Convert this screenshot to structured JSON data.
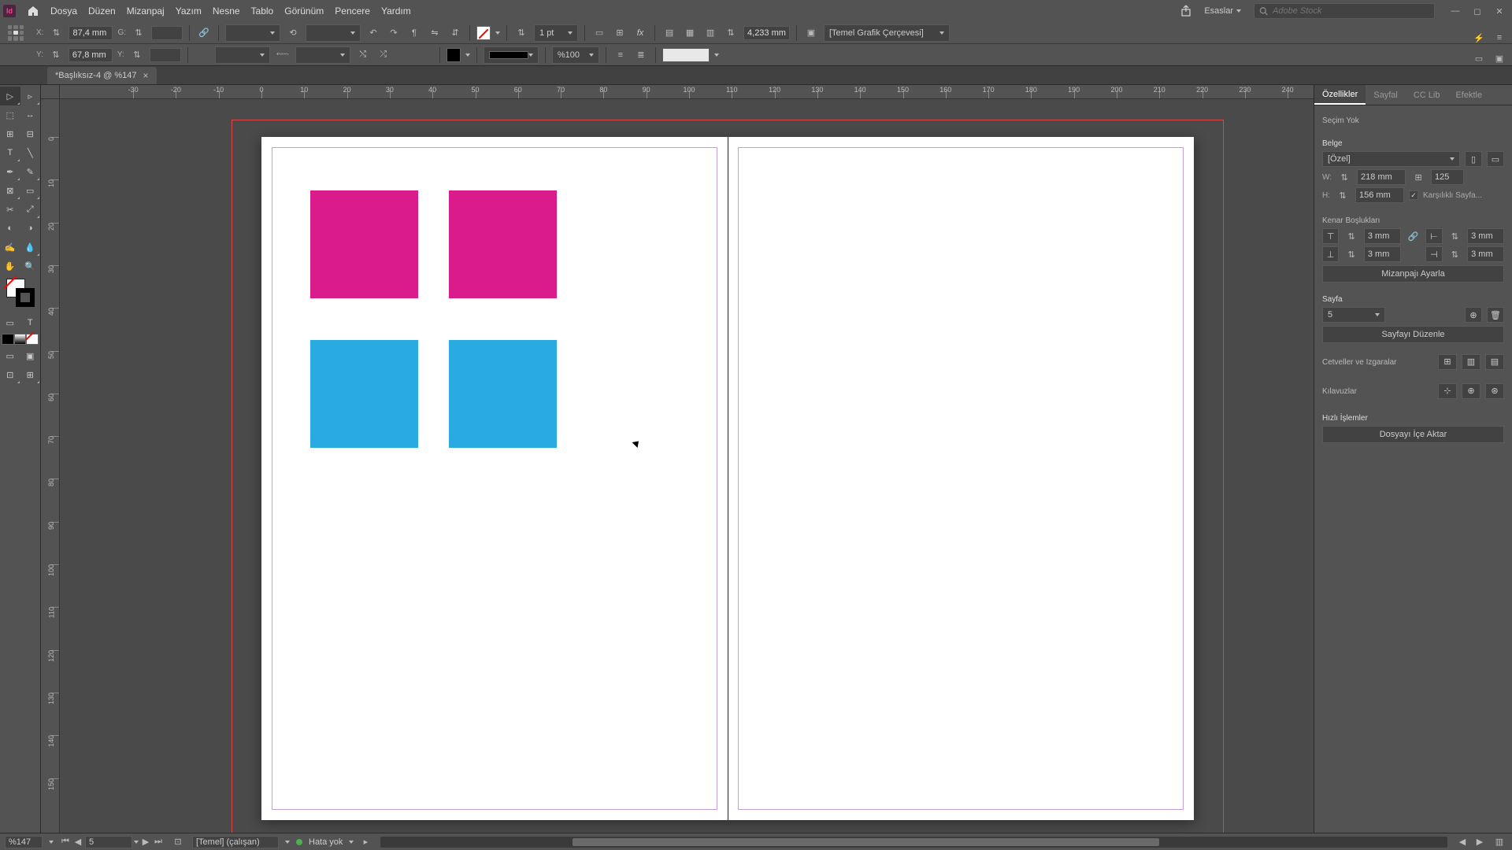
{
  "menu": {
    "file": "Dosya",
    "edit": "Düzen",
    "layout": "Mizanpaj",
    "type": "Yazım",
    "object": "Nesne",
    "table": "Tablo",
    "view": "Görünüm",
    "window": "Pencere",
    "help": "Yardım"
  },
  "workspace": "Esaslar",
  "search_placeholder": "Adobe Stock",
  "control": {
    "x": "87,4 mm",
    "y": "67,8 mm",
    "g": "",
    "stroke_weight": "1 pt",
    "corner": "4,233 mm",
    "zoom": "%100",
    "object_style": "[Temel Grafik Çerçevesi]",
    "opacity": ""
  },
  "doc_tab": "*Başlıksız-4 @ %147",
  "ruler_h": [
    -30,
    -20,
    -10,
    0,
    10,
    20,
    30,
    40,
    50,
    60,
    70,
    80,
    90,
    100,
    110,
    120,
    130,
    140,
    150,
    160,
    170,
    180,
    190,
    200,
    210,
    220,
    230,
    240
  ],
  "ruler_v": [
    0,
    10,
    20,
    30,
    40,
    50,
    60,
    70,
    80,
    90,
    100,
    110,
    120,
    130,
    140,
    150
  ],
  "panel": {
    "tabs": {
      "properties": "Özellikler",
      "pages": "Sayfal",
      "cclib": "CC Lib",
      "effects": "Efektle"
    },
    "no_selection": "Seçim Yok",
    "document": "Belge",
    "preset": "[Özel]",
    "w_label": "W:",
    "w": "218 mm",
    "h_label": "H:",
    "h": "156 mm",
    "pages": "125",
    "facing": "Karşılıklı Sayfa...",
    "margins_title": "Kenar Boşlukları",
    "m1": "3 mm",
    "m2": "3 mm",
    "m3": "3 mm",
    "m4": "3 mm",
    "adjust_layout": "Mizanpajı Ayarla",
    "page_title": "Sayfa",
    "page_num": "5",
    "edit_page": "Sayfayı Düzenle",
    "rulers_grids": "Cetveller ve Izgaralar",
    "guides": "Kılavuzlar",
    "quick": "Hızlı İşlemler",
    "place": "Dosyayı İçe Aktar"
  },
  "status": {
    "zoom": "%147",
    "page": "5",
    "preset": "[Temel] (çalışan)",
    "errors": "Hata yok"
  },
  "shapes": {
    "magenta": "#d91b8c",
    "cyan": "#29abe2"
  }
}
